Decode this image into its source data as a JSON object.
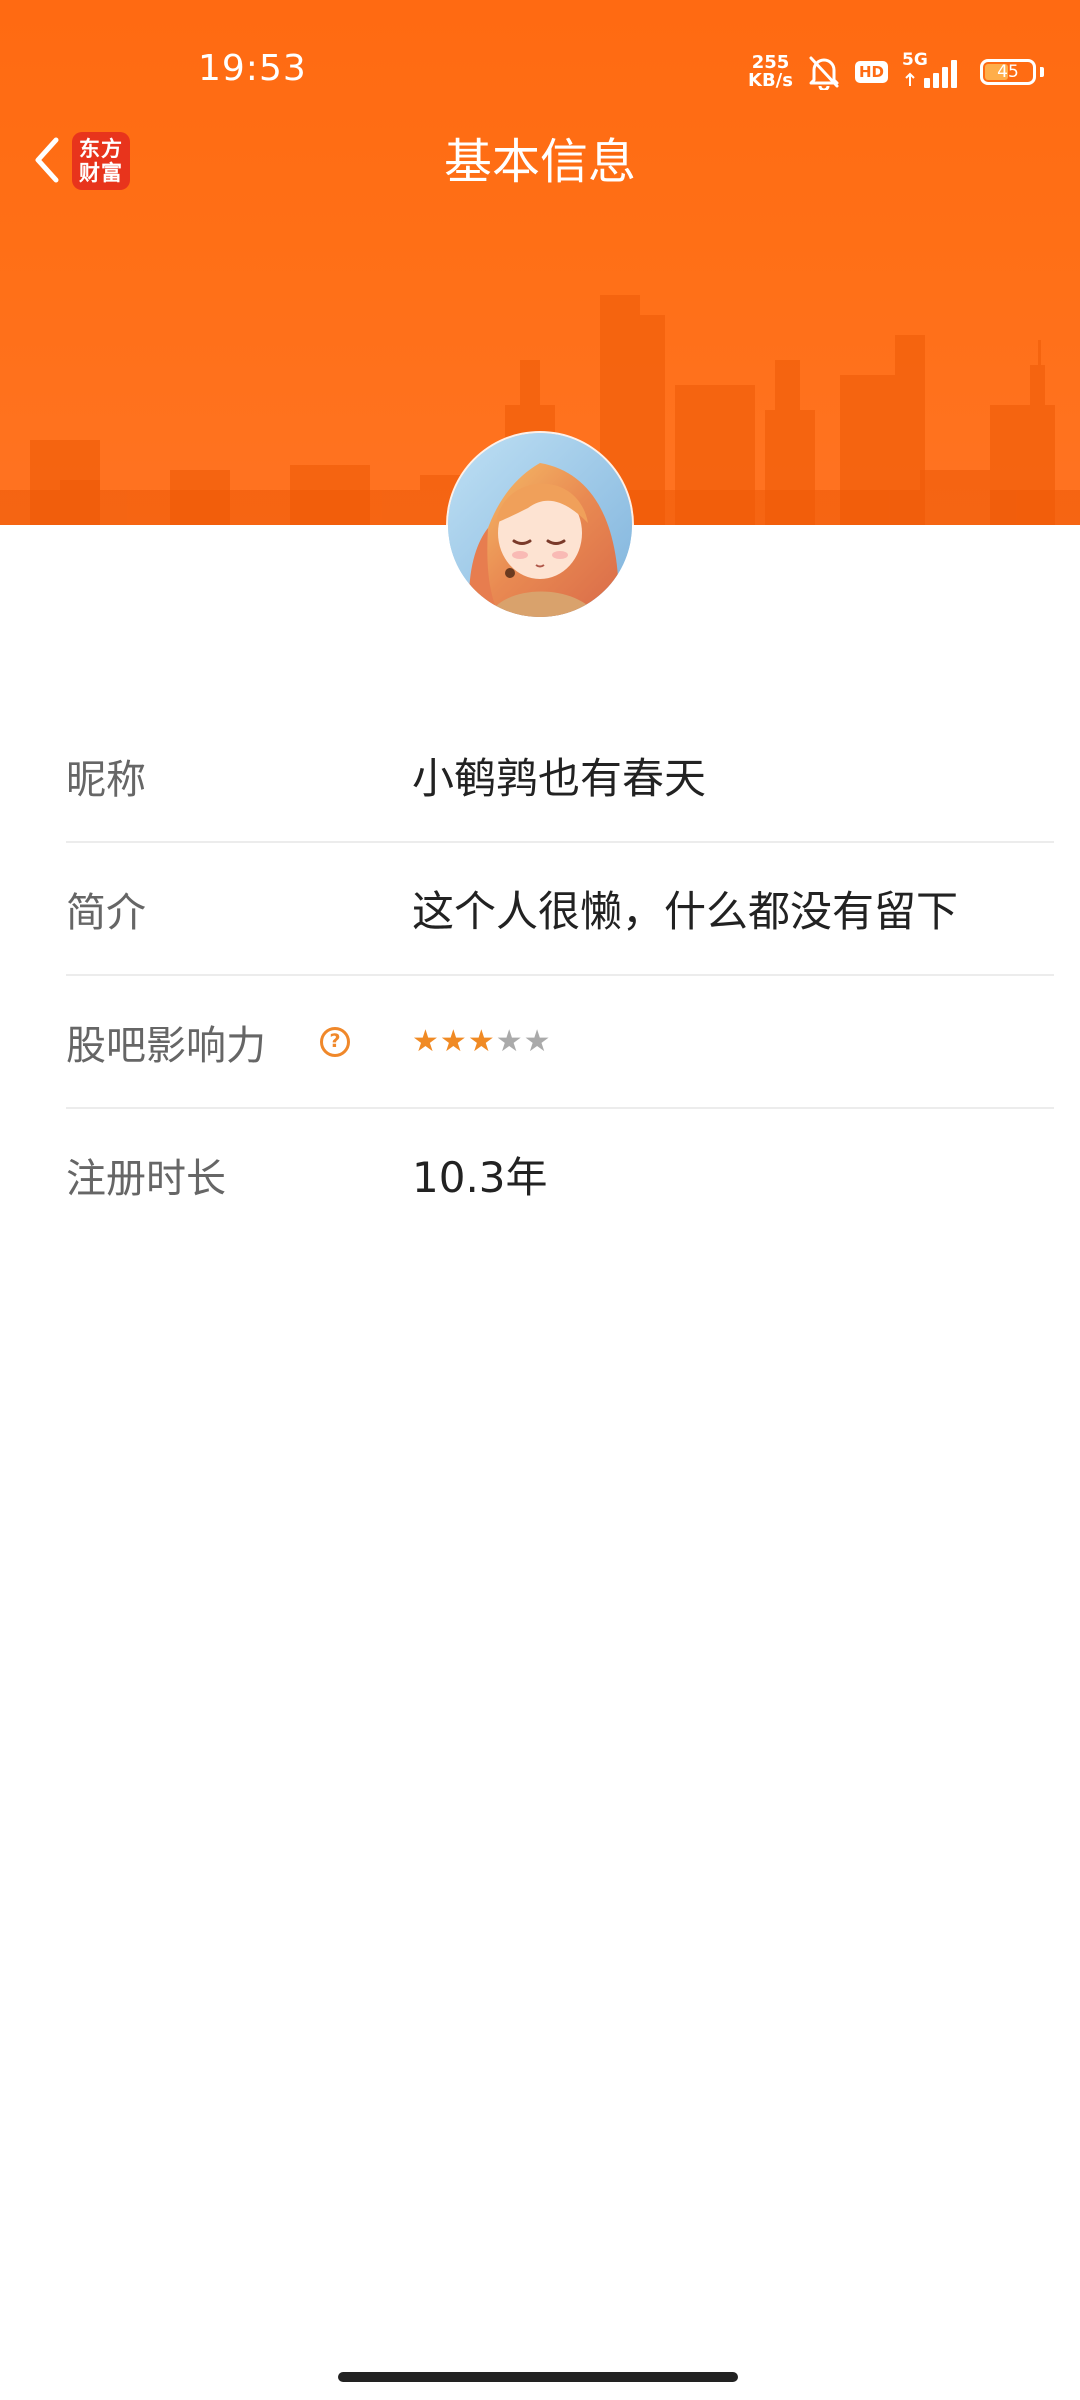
{
  "status_bar": {
    "time": "19:53",
    "net_speed_value": "255",
    "net_speed_unit": "KB/s",
    "hd_label": "HD",
    "signal_label": "5G",
    "battery_level": "45",
    "icons": [
      "mute-bell-icon",
      "hd-icon",
      "signal-icon",
      "battery-icon"
    ]
  },
  "nav": {
    "back_icon": "chevron-left-icon",
    "app_logo_line1": "东方",
    "app_logo_line2": "财富",
    "title": "基本信息"
  },
  "profile": {
    "avatar_icon": "anime-avatar-image"
  },
  "info_rows": [
    {
      "label": "昵称",
      "value": "小鹌鹑也有春天"
    },
    {
      "label": "简介",
      "value": "这个人很懒，什么都没有留下"
    },
    {
      "label": "股吧影响力",
      "help_icon": "question-circle-icon",
      "rating": 3,
      "rating_max": 5
    },
    {
      "label": "注册时长",
      "value": "10.3年"
    }
  ],
  "colors": {
    "header": "#ff6a12",
    "accent": "#f08a24",
    "logo_red": "#e8341c"
  }
}
